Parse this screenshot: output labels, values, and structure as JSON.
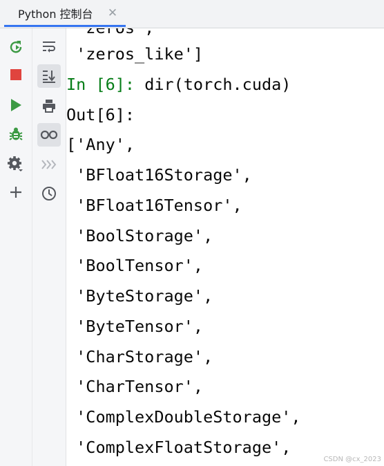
{
  "tab": {
    "title": "Python 控制台",
    "close": "✕"
  },
  "console": {
    "partial_top": " 'zeros',",
    "lines": [
      " 'zeros_like']",
      "In [6]: dir(torch.cuda)",
      "Out[6]: ",
      "['Any',",
      " 'BFloat16Storage',",
      " 'BFloat16Tensor',",
      " 'BoolStorage',",
      " 'BoolTensor',",
      " 'ByteStorage',",
      " 'ByteTensor',",
      " 'CharStorage',",
      " 'CharTensor',",
      " 'ComplexDoubleStorage',",
      " 'ComplexFloatStorage',"
    ],
    "input_prompt": "In [6]:",
    "input_code": " dir(torch.cuda)"
  },
  "watermark": "CSDN @cx_2023",
  "colors": {
    "accent": "#3574f0",
    "green": "#3c9a44",
    "red": "#e0443e",
    "prompt_green": "#067d17"
  },
  "icons": {
    "left_strip": [
      "rerun-icon",
      "stop-icon",
      "run-icon",
      "debug-icon",
      "settings-icon",
      "add-icon"
    ],
    "right_strip": [
      "soft-wrap-icon",
      "scroll-to-end-icon",
      "print-icon",
      "show-variables-icon",
      "command-queue-icon",
      "history-icon"
    ]
  }
}
